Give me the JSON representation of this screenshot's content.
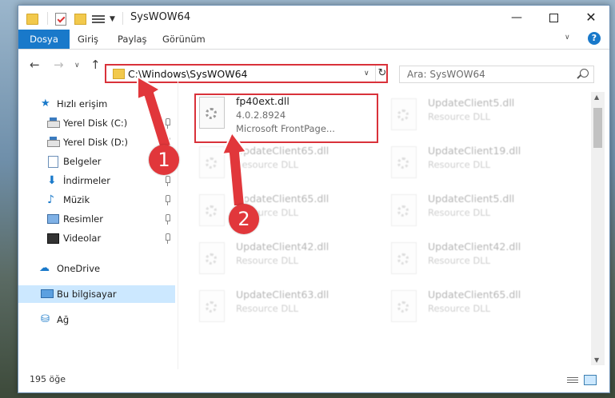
{
  "window": {
    "title": "SysWOW64",
    "minimize": "—",
    "close": "✕"
  },
  "ribbon": {
    "tabs": [
      "Dosya",
      "Giriş",
      "Paylaş",
      "Görünüm"
    ],
    "help": "?"
  },
  "address": {
    "path": "C:\\Windows\\SysWOW64",
    "refresh": "↻"
  },
  "search": {
    "placeholder": "Ara: SysWOW64"
  },
  "sidebar": {
    "items": [
      {
        "label": "Hızlı erişim",
        "icon": "star-icon"
      },
      {
        "label": "Yerel Disk (C:)",
        "icon": "disk-icon",
        "pinned": true
      },
      {
        "label": "Yerel Disk (D:)",
        "icon": "disk-icon",
        "pinned": true
      },
      {
        "label": "Belgeler",
        "icon": "documents-icon",
        "pinned": true
      },
      {
        "label": "İndirmeler",
        "icon": "downloads-icon",
        "pinned": true
      },
      {
        "label": "Müzik",
        "icon": "music-icon",
        "pinned": true
      },
      {
        "label": "Resimler",
        "icon": "pictures-icon",
        "pinned": true
      },
      {
        "label": "Videolar",
        "icon": "videos-icon",
        "pinned": true
      },
      {
        "label": "OneDrive",
        "icon": "cloud-icon"
      },
      {
        "label": "Bu bilgisayar",
        "icon": "computer-icon",
        "selected": true
      },
      {
        "label": "Ağ",
        "icon": "network-icon"
      }
    ]
  },
  "files": {
    "selected": {
      "name": "fp40ext.dll",
      "version": "4.0.2.8924",
      "description": "Microsoft FrontPage..."
    },
    "left": [
      {
        "name": "UpdateClient65.dll",
        "type": "Resource DLL"
      },
      {
        "name": "UpdateClient65.dll",
        "type": "Resource DLL"
      },
      {
        "name": "UpdateClient42.dll",
        "type": "Resource DLL"
      },
      {
        "name": "UpdateClient63.dll",
        "type": "Resource DLL"
      }
    ],
    "right": [
      {
        "name": "UpdateClient5.dll",
        "type": "Resource DLL"
      },
      {
        "name": "UpdateClient19.dll",
        "type": "Resource DLL"
      },
      {
        "name": "UpdateClient5.dll",
        "type": "Resource DLL"
      },
      {
        "name": "UpdateClient42.dll",
        "type": "Resource DLL"
      },
      {
        "name": "UpdateClient65.dll",
        "type": "Resource DLL"
      }
    ]
  },
  "status": {
    "count": "195 öğe"
  },
  "callouts": [
    "1",
    "2"
  ],
  "colors": {
    "accent": "#1979ca",
    "highlight": "#d9323a",
    "callout": "#e1373b"
  }
}
